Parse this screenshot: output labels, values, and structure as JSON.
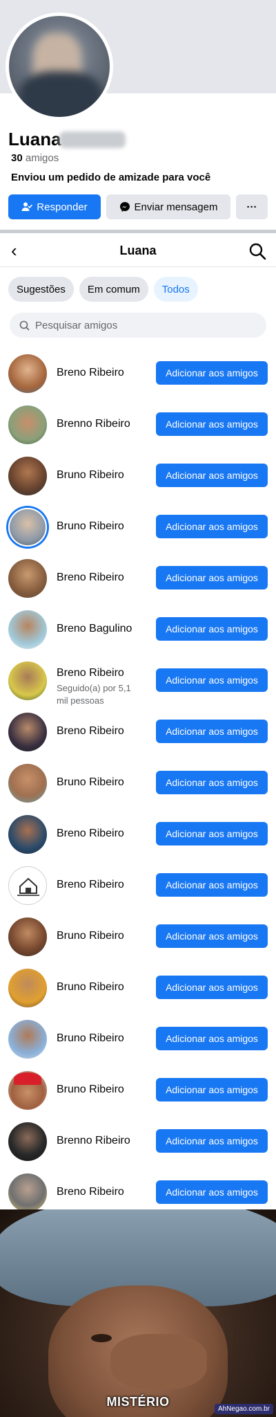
{
  "profile": {
    "name": "Luana",
    "friends_count": "30",
    "friends_label": "amigos",
    "request_text": "Enviou um pedido de amizade para você",
    "respond_label": "Responder",
    "message_label": "Enviar mensagem",
    "more_label": "···"
  },
  "friends_nav": {
    "back_icon": "back-arrow-icon",
    "title": "Luana",
    "search_icon": "search-icon"
  },
  "filters": [
    "Sugestões",
    "Em comum",
    "Todos"
  ],
  "search": {
    "placeholder": "Pesquisar amigos"
  },
  "add_label": "Adicionar aos amigos",
  "friends": [
    {
      "name": "Breno Ribeiro"
    },
    {
      "name": "Brenno Ribeiro"
    },
    {
      "name": "Bruno Ribeiro"
    },
    {
      "name": "Bruno Ribeiro"
    },
    {
      "name": "Breno Ribeiro"
    },
    {
      "name": "Breno Bagulino"
    },
    {
      "name": "Breno Ribeiro",
      "sub": "Seguido(a) por 5,1 mil pessoas"
    },
    {
      "name": "Breno Ribeiro"
    },
    {
      "name": "Bruno Ribeiro"
    },
    {
      "name": "Breno Ribeiro"
    },
    {
      "name": "Breno Ribeiro"
    },
    {
      "name": "Bruno Ribeiro"
    },
    {
      "name": "Bruno Ribeiro"
    },
    {
      "name": "Bruno Ribeiro"
    },
    {
      "name": "Bruno Ribeiro"
    },
    {
      "name": "Brenno Ribeiro"
    },
    {
      "name": "Breno Ribeiro"
    }
  ],
  "meme": {
    "caption": "MISTÉRIO",
    "watermark": "AhNegao.com.br"
  },
  "colors": {
    "accent": "#1877f2",
    "chip_active_bg": "#e7f3ff"
  }
}
